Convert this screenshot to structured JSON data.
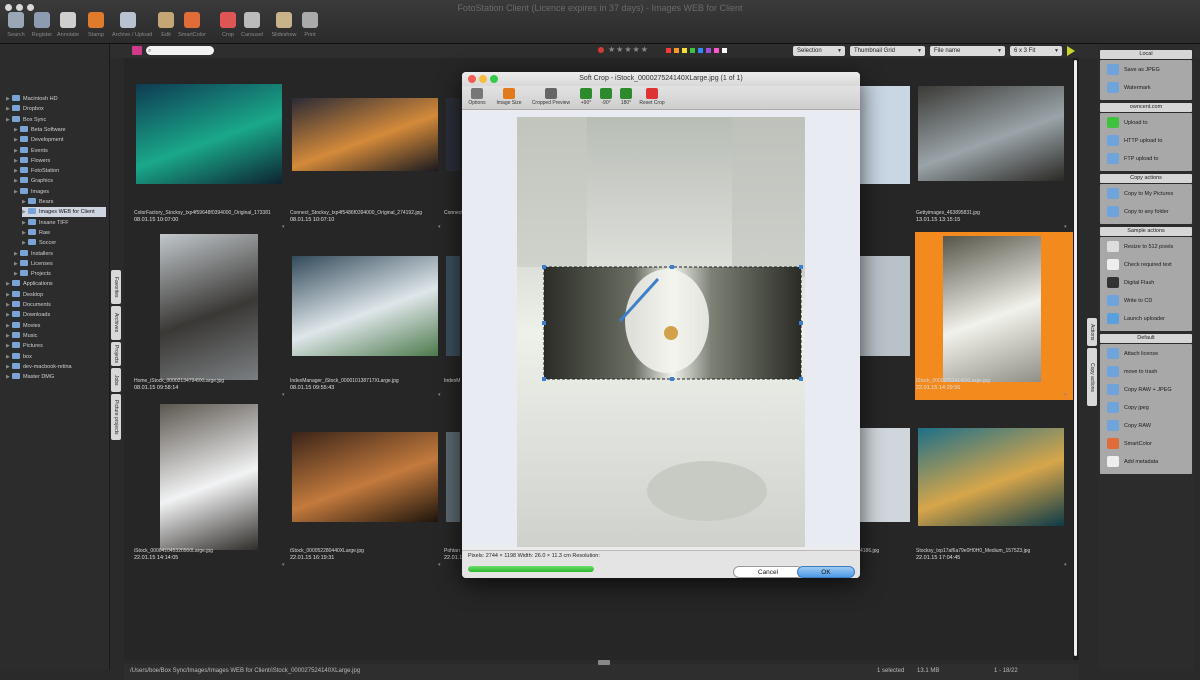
{
  "window": {
    "title": "FotoStation Client (Licence expires in 37 days) - Images WEB for Client"
  },
  "toolbar": [
    {
      "label": "Search",
      "icon": "magnifier-icon",
      "color": "#9aa7b6"
    },
    {
      "label": "Register",
      "icon": "user-register-icon",
      "color": "#8d9bb0"
    },
    {
      "label": "Annotate",
      "icon": "annotate-icon",
      "color": "#cfcfcf"
    },
    {
      "label": "Stamp",
      "icon": "stamp-icon",
      "color": "#e07b2c"
    },
    {
      "label": "Archive / Upload",
      "icon": "archive-icon",
      "color": "#b9c2d0"
    },
    {
      "label": "Edit",
      "icon": "palette-icon",
      "color": "#c4a574"
    },
    {
      "label": "SmartColor",
      "icon": "smartcolor-icon",
      "color": "#e06c3a"
    },
    {
      "label": "Crop",
      "icon": "crop-icon",
      "color": "#d55"
    },
    {
      "label": "Carousel",
      "icon": "eye-icon",
      "color": "#bbb"
    },
    {
      "label": "Slideshow",
      "icon": "slideshow-icon",
      "color": "#c9b48a"
    },
    {
      "label": "Print",
      "icon": "printer-icon",
      "color": "#aaa"
    }
  ],
  "filterbar": {
    "search_placeholder": "",
    "stars": "★★★★★",
    "swatches": [
      "#ff3b3b",
      "#ff9a2a",
      "#f5e03a",
      "#3ec43e",
      "#2e8bff",
      "#a050e0",
      "#ff58c8",
      "#ffffff"
    ],
    "selection": "Selection",
    "view_mode": "Thumbnail Grid",
    "sort": "File name",
    "grid_size": "6 x 3 Fit"
  },
  "tree": [
    {
      "label": "Macintosh HD",
      "indent": 0,
      "sel": false
    },
    {
      "label": "Dropbox",
      "indent": 0,
      "sel": false
    },
    {
      "label": "Box Sync",
      "indent": 0,
      "sel": false
    },
    {
      "label": "Beta Software",
      "indent": 1,
      "sel": false
    },
    {
      "label": "Development",
      "indent": 1,
      "sel": false
    },
    {
      "label": "Events",
      "indent": 1,
      "sel": false
    },
    {
      "label": "Flowers",
      "indent": 1,
      "sel": false
    },
    {
      "label": "FotoStation",
      "indent": 1,
      "sel": false
    },
    {
      "label": "Graphics",
      "indent": 1,
      "sel": false
    },
    {
      "label": "Images",
      "indent": 1,
      "sel": false
    },
    {
      "label": "Bears",
      "indent": 2,
      "sel": false
    },
    {
      "label": "Images WEB for Client",
      "indent": 2,
      "sel": true
    },
    {
      "label": "Insane TIFF",
      "indent": 2,
      "sel": false
    },
    {
      "label": "Raw",
      "indent": 2,
      "sel": false
    },
    {
      "label": "Soccer",
      "indent": 2,
      "sel": false
    },
    {
      "label": "Installers",
      "indent": 1,
      "sel": false
    },
    {
      "label": "Licenses",
      "indent": 1,
      "sel": false
    },
    {
      "label": "Projects",
      "indent": 1,
      "sel": false
    },
    {
      "label": "Applications",
      "indent": 0,
      "sel": false
    },
    {
      "label": "Desktop",
      "indent": 0,
      "sel": false
    },
    {
      "label": "Documents",
      "indent": 0,
      "sel": false
    },
    {
      "label": "Downloads",
      "indent": 0,
      "sel": false
    },
    {
      "label": "Movies",
      "indent": 0,
      "sel": false
    },
    {
      "label": "Music",
      "indent": 0,
      "sel": false
    },
    {
      "label": "Pictures",
      "indent": 0,
      "sel": false
    },
    {
      "label": "box",
      "indent": 0,
      "sel": false
    },
    {
      "label": "dev-macbook-retina",
      "indent": 0,
      "sel": false
    },
    {
      "label": "Master DMG",
      "indent": 0,
      "sel": false
    }
  ],
  "left_tabs": [
    "Favorites",
    "Archives",
    "Projects",
    "Jobs",
    "Picture projects"
  ],
  "thumbs": [
    {
      "name": "ColorFactory_Stocksy_txp4f59648f0394000_Original_173381",
      "date": "08.01.15 10:07:00",
      "colors": [
        "#0e3b52",
        "#1aa88a",
        "#0d2230"
      ]
    },
    {
      "name": "Connect_Stocksy_txp4f5486f0394000_Original_274192.jpg",
      "date": "08.01.15 10:07:10",
      "colors": [
        "#2b2a35",
        "#d48a3a",
        "#1b1a20"
      ]
    },
    {
      "name": "Gettyimages_463895831.jpg",
      "date": "13.01.15 13:15:15",
      "colors": [
        "#3b3a36",
        "#9aa4a9",
        "#2a2824"
      ]
    },
    {
      "name": "Home_iStock_000021347949XLarge.jpg",
      "date": "08.01.15 09:58:14",
      "colors": [
        "#c2c8cc",
        "#3a3835",
        "#7b7f82"
      ]
    },
    {
      "name": "IndexManager_iStock_000010138717XLarge.jpg",
      "date": "08.01.15 09:55:43",
      "colors": [
        "#324a5a",
        "#dfe6ea",
        "#4c7a4c"
      ]
    },
    {
      "name": "iStock_000027524140XLarge.jpg",
      "date": "22.01.15 14:29:56",
      "colors": [
        "#555548",
        "#f2f2ec",
        "#8f8f85"
      ]
    },
    {
      "name": "iStock_000041045320900Large.jpg",
      "date": "22.01.15 14:14:05",
      "colors": [
        "#5b564f",
        "#f2f3f4",
        "#2f2c29"
      ]
    },
    {
      "name": "iStock_000052280440XLarge.jpg",
      "date": "22.01.15 16:19:31",
      "colors": [
        "#3a2418",
        "#c37a3d",
        "#1e140d"
      ]
    },
    {
      "name": "Stocksy_txp17af6a79e0H0H0_Medium_157523.jpg",
      "date": "22.01.15 17:04:45",
      "colors": [
        "#1e6f89",
        "#d7a64a",
        "#0d3a48"
      ]
    }
  ],
  "partial_thumbs": [
    {
      "name": "Connect_",
      "date": ""
    },
    {
      "name": "IndexM",
      "date": ""
    },
    {
      "name": "Pohtan",
      "date": "22.01.1"
    },
    {
      "name": "",
      "date": ""
    },
    {
      "name": "",
      "date": ""
    },
    {
      "name": "4186.jpg",
      "date": ""
    }
  ],
  "status": {
    "path": "/Users/boe/Box Sync/Images/Images WEB for Client/iStock_000027524140XLarge.jpg",
    "selected": "1 selected",
    "size": "13.1 MB",
    "count": "1 - 18/22"
  },
  "dialog": {
    "title": "Soft Crop - iStock_000027524140XLarge.jpg (1 of 1)",
    "tools": [
      {
        "label": "Options",
        "icon": "options-icon"
      },
      {
        "label": "Image Size",
        "icon": "pencil-icon"
      },
      {
        "label": "Cropped Preview",
        "icon": "crop-preview-icon"
      },
      {
        "label": "+90°",
        "icon": "rotate-cw-icon"
      },
      {
        "label": "-90°",
        "icon": "rotate-ccw-icon"
      },
      {
        "label": "180°",
        "icon": "rotate-180-icon"
      },
      {
        "label": "Reset Crop",
        "icon": "reset-icon"
      }
    ],
    "info": "Pixels: 2744 × 1198  Width: 26.0 × 11.3 cm  Resolution:",
    "progress": 1.0,
    "cancel": "Cancel",
    "ok": "OK"
  },
  "actions": {
    "sections": [
      {
        "title": "Local",
        "items": [
          {
            "label": "Save as JPEG",
            "icon": "folder-icon",
            "color": "#6fa3dc"
          },
          {
            "label": "Watermark",
            "icon": "folder-icon",
            "color": "#6fa3dc"
          }
        ]
      },
      {
        "title": "owncent.com",
        "items": [
          {
            "label": "Upload to",
            "icon": "green-arrow-icon",
            "color": "#3fc33f"
          },
          {
            "label": "HTTP upload to",
            "icon": "folder-icon",
            "color": "#6fa3dc"
          },
          {
            "label": "FTP upload to",
            "icon": "folder-icon",
            "color": "#6fa3dc"
          }
        ]
      },
      {
        "title": "Copy actions",
        "items": [
          {
            "label": "Copy to My Pictures",
            "icon": "folder-icon",
            "color": "#6fa3dc"
          },
          {
            "label": "Copy to any folder",
            "icon": "folder-icon",
            "color": "#6fa3dc"
          }
        ]
      },
      {
        "title": "Sample actions",
        "items": [
          {
            "label": "Resize to 512 pixels",
            "icon": "gear-icon",
            "color": "#ddd"
          },
          {
            "label": "Check required text",
            "icon": "document-icon",
            "color": "#eee"
          },
          {
            "label": "Digital Flash",
            "icon": "flash-icon",
            "color": "#333"
          },
          {
            "label": "Write to CD",
            "icon": "folder-icon",
            "color": "#6fa3dc"
          },
          {
            "label": "Launch uploader",
            "icon": "globe-icon",
            "color": "#5aa0e0"
          }
        ]
      },
      {
        "title": "Default",
        "items": [
          {
            "label": "Attach license",
            "icon": "folder-icon",
            "color": "#6fa3dc"
          },
          {
            "label": "move to trash",
            "icon": "folder-icon",
            "color": "#6fa3dc"
          },
          {
            "label": "Copy RAW + JPEG",
            "icon": "folder-icon",
            "color": "#6fa3dc"
          },
          {
            "label": "Copy jpeg",
            "icon": "folder-icon",
            "color": "#6fa3dc"
          },
          {
            "label": "Copy RAW",
            "icon": "folder-icon",
            "color": "#6fa3dc"
          },
          {
            "label": "SmartColor",
            "icon": "smartcolor-icon",
            "color": "#e06c3a"
          },
          {
            "label": "Add metadata",
            "icon": "document-icon",
            "color": "#eee"
          }
        ]
      }
    ]
  },
  "right_tabs": [
    "Actions",
    "Copy actions"
  ]
}
